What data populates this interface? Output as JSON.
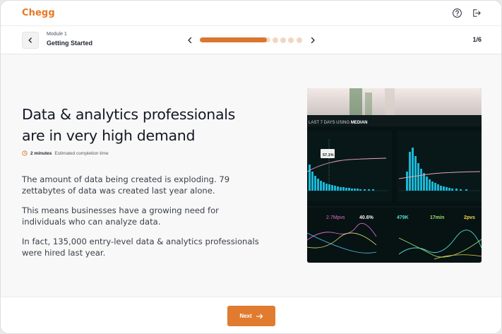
{
  "app": {
    "logo_text": "Chegg"
  },
  "header": {
    "help_icon": "help-circle-icon",
    "logout_icon": "logout-icon"
  },
  "module": {
    "label": "Module 1",
    "title": "Getting Started",
    "page_count": "1/6",
    "progress": {
      "current_step": 1,
      "total_steps": 6,
      "fill_fraction": 0.95
    }
  },
  "content": {
    "heading": "Data & analytics professionals are in very high demand",
    "duration": "2 minutes",
    "duration_suffix": "Estimated completion time",
    "paragraphs": [
      "The amount of data being created is exploding. 79 zettabytes of data was created last year alone.",
      "This means businesses have a growing need for individuals who can analyze data.",
      "In fact, 135,000 entry-level data & analytics professionals were hired last year."
    ],
    "image": {
      "dashboard_title_prefix": "LAST 7 DAYS USING",
      "dashboard_title_emph": "MEDIAN",
      "callout": "57.1%",
      "stats": [
        "2.7Mpvs",
        "40.6%",
        "479K",
        "17min",
        "2pvs"
      ]
    }
  },
  "footer": {
    "next_label": "Next"
  },
  "colors": {
    "brand": "#e87722",
    "button": "#e07b2f",
    "progress": "#d9772e"
  }
}
